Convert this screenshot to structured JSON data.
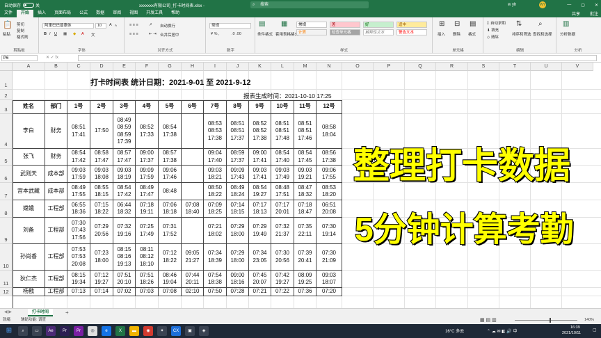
{
  "window": {
    "autosave_label": "自动保存",
    "toggle_state": "关",
    "doc_title": "xxxxxxx有限公司_打卡时间表.xlsx  -",
    "search_placeholder": "搜索",
    "user_name": "w yh",
    "avatar_initials": "WY",
    "minimize": "—",
    "maximize": "▢",
    "close": "✕"
  },
  "ribbon_tabs": [
    "文件",
    "开始",
    "插入",
    "页面布局",
    "公式",
    "数据",
    "审阅",
    "视图",
    "开发工具",
    "帮助"
  ],
  "ribbon_share": "共享",
  "ribbon_comment": "批注",
  "ribbon": {
    "clipboard": {
      "paste": "粘贴",
      "cut": "剪切",
      "copy": "复制",
      "format_painter": "格式刷",
      "label": "剪贴板"
    },
    "font": {
      "font_name": "阿里巴巴普惠体",
      "font_size": "10",
      "bold": "B",
      "italic": "I",
      "underline": "U",
      "grow": "A",
      "shrink": "A",
      "label": "字体"
    },
    "alignment": {
      "wrap": "自动换行",
      "merge": "合并后居中",
      "label": "对齐方式"
    },
    "number": {
      "format": "常规",
      "label": "数字"
    },
    "styles": {
      "conditional": "条件格式",
      "table": "套用表格格式",
      "normal": "常规",
      "bad": "差",
      "good": "好",
      "neutral": "适中",
      "calc": "计算",
      "check": "检查单元格",
      "explain": "解释性文本",
      "warning": "警告文本",
      "label": "样式"
    },
    "cells": {
      "insert": "插入",
      "delete": "删除",
      "format": "格式",
      "label": "单元格"
    },
    "editing": {
      "autosum": "自动求和",
      "fill": "填充",
      "clear": "清除",
      "sort": "排序和筛选",
      "find": "查找和选择",
      "label": "编辑"
    },
    "analysis": {
      "analyze": "分析数据",
      "label": "分析"
    }
  },
  "formula_bar": {
    "name_box": "P6",
    "fx": "fx"
  },
  "columns": [
    "A",
    "B",
    "C",
    "D",
    "E",
    "F",
    "G",
    "H",
    "I",
    "J",
    "K",
    "L",
    "M",
    "N",
    "O",
    "P",
    "Q",
    "R",
    "S",
    "T",
    "U",
    "V"
  ],
  "rows": [
    "1",
    "2",
    "3",
    "4",
    "5",
    "6",
    "7",
    "8",
    "9",
    "10",
    "11",
    "12"
  ],
  "report": {
    "title": "打卡时间表 统计日期：2021-9-01 至 2021-9-12",
    "generated": "报表生成时间：2021-10-10 17:25",
    "headers": [
      "姓名",
      "部门",
      "1号",
      "2号",
      "3号",
      "4号",
      "5号",
      "6号",
      "7号",
      "8号",
      "9号",
      "10号",
      "11号",
      "12号"
    ],
    "records": [
      [
        "李白",
        "财务",
        "08:51\n17:41",
        "17:50",
        "08:49\n08:59\n08:59\n17:39",
        "08:52\n17:33",
        "08:54\n17:38",
        "",
        "08:53\n08:53\n17:38",
        "08:51\n08:51\n17:37",
        "08:52\n08:52\n17:38",
        "08:51\n08:51\n17:48",
        "08:51\n08:51\n17:46",
        "08:58\n18:04"
      ],
      [
        "张飞",
        "财务",
        "08:54\n17:42",
        "08:58\n17:47",
        "08:57\n17:47",
        "09:00\n17:37",
        "08:57\n17:38",
        "",
        "09:04\n17:40",
        "08:59\n17:37",
        "09:00\n17:41",
        "08:54\n17:40",
        "08:54\n17:45",
        "08:56\n17:38"
      ],
      [
        "武则天",
        "成本部",
        "09:03\n17:59",
        "09:03\n18:08",
        "09:03\n18:19",
        "09:09\n17:59",
        "09:06\n17:46",
        "",
        "09:03\n18:21",
        "09:09\n17:43",
        "09:03\n17:41",
        "09:03\n17:49",
        "09:03\n19:21",
        "09:06\n17:55"
      ],
      [
        "宫本武藏",
        "成本部",
        "08:49\n17:55",
        "08:55\n18:15",
        "08:54\n17:42",
        "08:49\n17:47",
        "08:48",
        "",
        "08:50\n18:22",
        "08:49\n18:24",
        "08:54\n19:27",
        "08:48\n17:51",
        "08:47\n18:32",
        "08:53\n18:20"
      ],
      [
        "嫦娥",
        "工程部",
        "06:55\n18:36",
        "07:15\n18:22",
        "06:44\n18:32",
        "07:18\n19:11",
        "07:06\n18:18",
        "07:08\n18:40",
        "07:09\n18:25",
        "07:14\n18:15",
        "07:17\n18:13",
        "07:17\n20:01",
        "07:18\n18:47",
        "06:51\n20:08"
      ],
      [
        "刘备",
        "工程部",
        "07:30\n07:43\n17:56",
        "07:29\n20:56",
        "07:32\n19:16",
        "07:25\n17:49",
        "07:31\n17:52",
        "",
        "07:21\n18:02",
        "07:29\n18:00",
        "07:29\n19:49",
        "07:32\n21:37",
        "07:35\n22:11",
        "07:30\n19:14"
      ],
      [
        "孙尚香",
        "工程部",
        "07:53\n07:53\n20:08",
        "07:23\n18:00",
        "08:15\n08:16\n19:13",
        "08:11\n08:12\n18:10",
        "07:12\n18:22",
        "09:05\n21:27",
        "07:34\n18:39",
        "07:29\n18:00",
        "07:34\n23:05",
        "07:30\n20:56",
        "07:39\n20:41",
        "07:30\n21:09"
      ],
      [
        "狄仁杰",
        "工程部",
        "08:15\n19:34",
        "07:12\n19:27",
        "07:51\n20:10",
        "07:51\n18:26",
        "08:46\n19:04",
        "07:44\n20:11",
        "07:54\n18:38",
        "09:00\n18:16",
        "07:45\n20:07",
        "07:42\n19:27",
        "08:09\n19:25",
        "09:03\n18:07"
      ],
      [
        "杨戬",
        "工程部",
        "07:13\n",
        "07:14\n",
        "07:02\n",
        "07:03\n",
        "07:08\n",
        "02:10\n",
        "07:50\n",
        "07:28\n",
        "07:21\n",
        "07:22\n",
        "07:36\n",
        "07:20\n"
      ]
    ]
  },
  "overlay": {
    "line1": "整理打卡数据",
    "line2": "5分钟计算考勤"
  },
  "sheet_tab": "打卡时间",
  "add_sheet": "+",
  "status": {
    "ready": "就绪",
    "accessibility": "辅助功能: 调查",
    "zoom": "140%"
  },
  "taskbar": {
    "weather": "16°C 多云",
    "time": "16:39",
    "date": "2021/10/11"
  },
  "colors": {
    "excel_green": "#217346",
    "overlay_yellow": "#ffff00"
  }
}
